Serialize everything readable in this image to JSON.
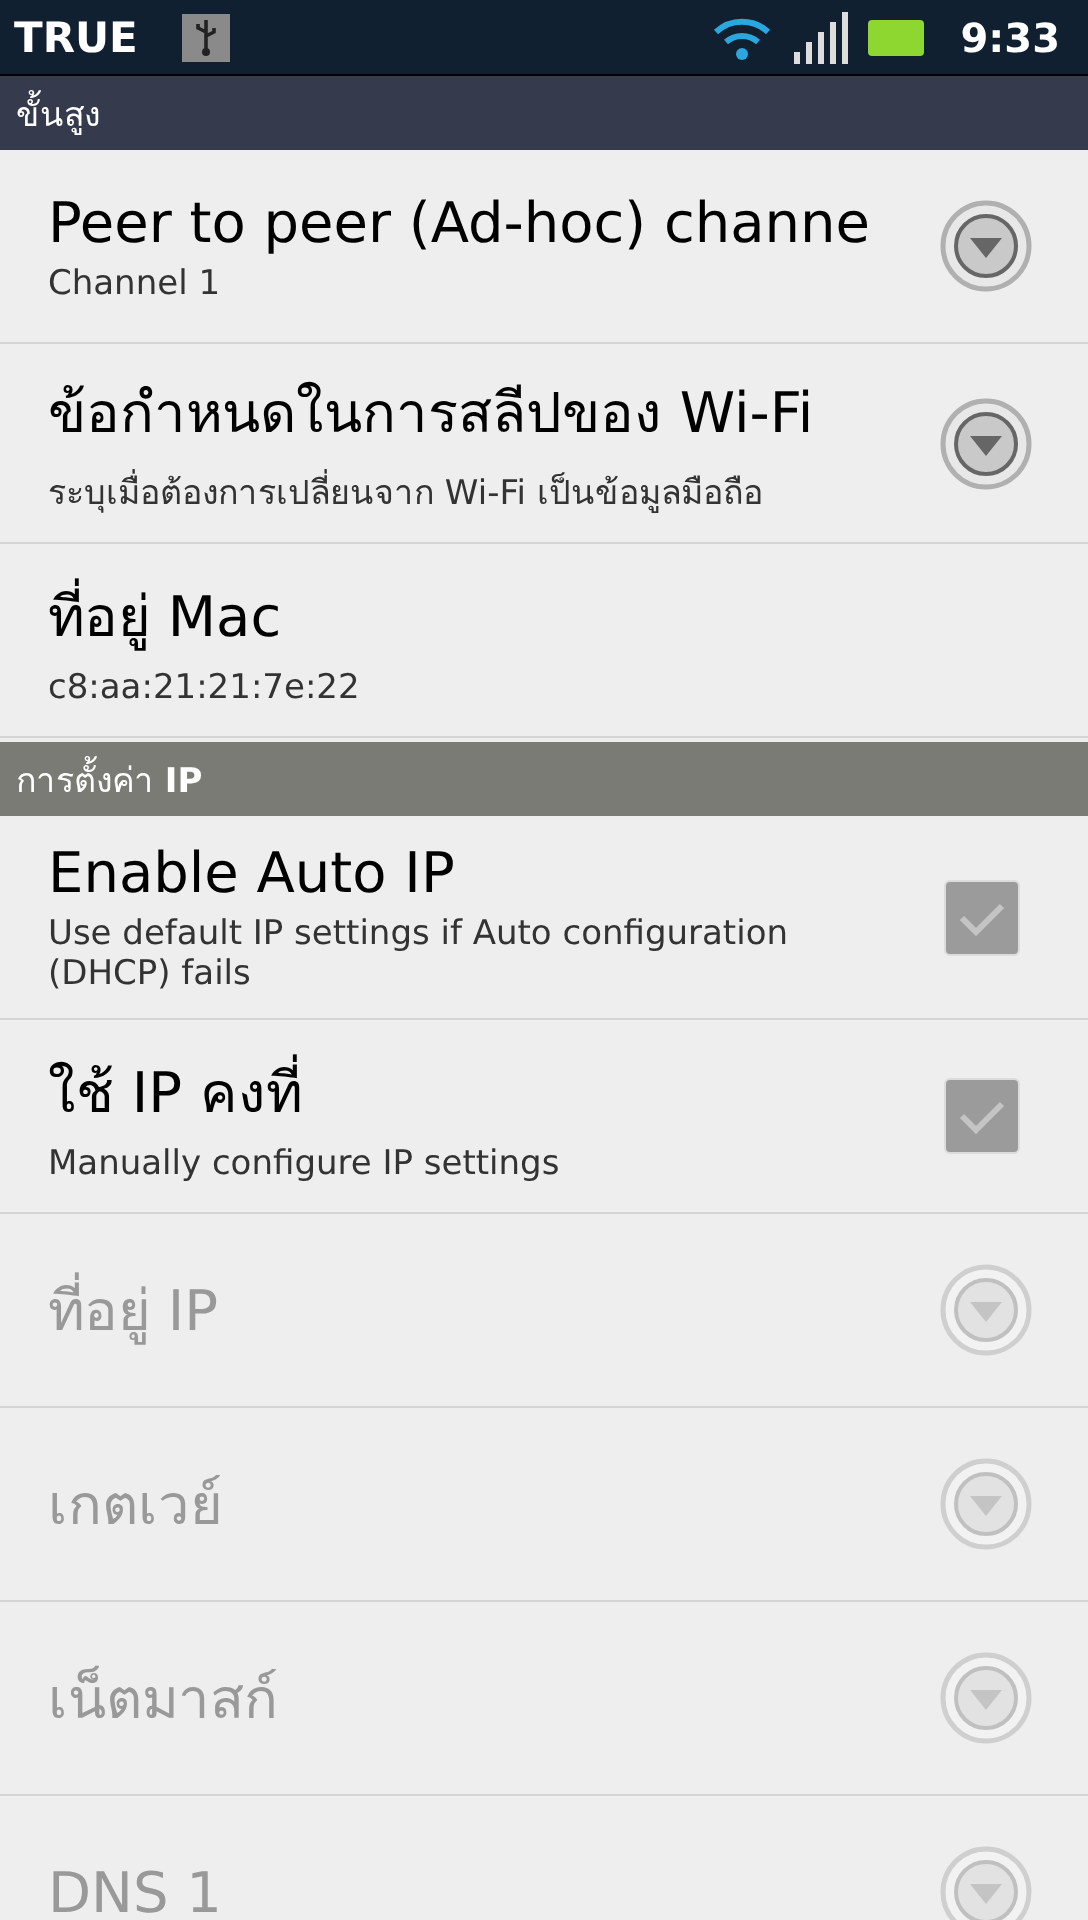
{
  "status_bar": {
    "carrier": "TRUE",
    "time": "9:33"
  },
  "title": "ขั้นสูง",
  "groups": [
    {
      "items": [
        {
          "kind": "dropdown",
          "title": "Peer to peer (Ad-hoc) channe",
          "summary": "Channel 1",
          "disabled": false
        },
        {
          "kind": "dropdown",
          "title": "ข้อกำหนดในการสลีปของ Wi-Fi",
          "summary": "ระบุเมื่อต้องการเปลี่ยนจาก Wi-Fi เป็นข้อมูลมือถือ",
          "disabled": false
        },
        {
          "kind": "info",
          "title": "ที่อยู่ Mac",
          "summary": "c8:aa:21:21:7e:22",
          "disabled": false
        }
      ]
    },
    {
      "header": "การตั้งค่า **IP**",
      "items": [
        {
          "kind": "checkbox",
          "title": "Enable Auto IP",
          "summary": "Use default IP settings if Auto configuration (DHCP) fails",
          "checked": true,
          "disabled": false
        },
        {
          "kind": "checkbox",
          "title": "ใช้ IP คงที่",
          "summary": "Manually configure IP settings",
          "checked": true,
          "disabled": false
        },
        {
          "kind": "dropdown",
          "title": "ที่อยู่ IP",
          "disabled": true
        },
        {
          "kind": "dropdown",
          "title": "เกตเวย์",
          "disabled": true
        },
        {
          "kind": "dropdown",
          "title": "เน็ตมาสก์",
          "disabled": true
        },
        {
          "kind": "dropdown",
          "title": "DNS 1",
          "disabled": true
        }
      ]
    }
  ]
}
